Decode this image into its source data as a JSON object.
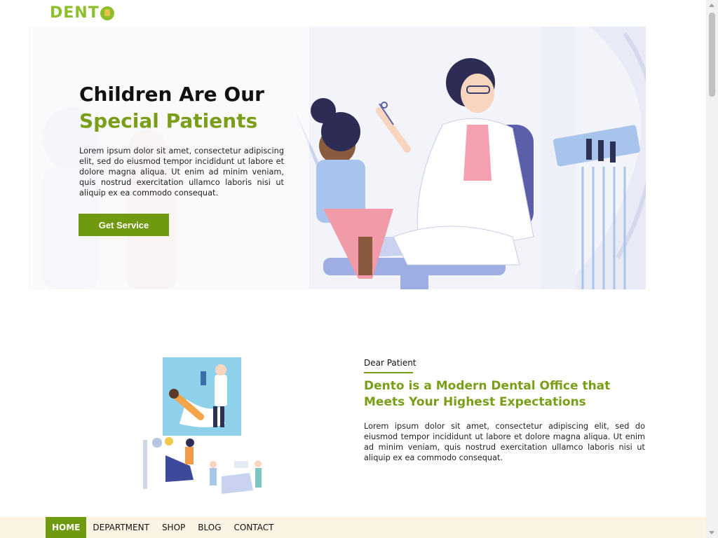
{
  "brand": {
    "logo_text": "DENT",
    "logo_icon": "tooth-icon"
  },
  "hero": {
    "title_line1": "Children Are Our",
    "title_line2": "Special Patients",
    "text": "Lorem ipsum dolor sit amet, consectetur adipiscing elit, sed do eiusmod tempor incididunt ut labore et dolore magna aliqua. Ut enim ad minim veniam, quis nostrud exercitation ullamco laboris nisi ut aliquip ex ea commodo consequat.",
    "button_label": "Get Service"
  },
  "about": {
    "kicker": "Dear Patient",
    "title": "Dento is a Modern Dental Office that Meets Your Highest Expectations",
    "text": "Lorem ipsum dolor sit amet, consectetur adipiscing elit, sed do eiusmod tempor incididunt ut labore et dolore magna aliqua. Ut enim ad minim veniam, quis nostrud exercitation ullamco laboris nisi ut aliquip ex ea commodo consequat."
  },
  "nav": {
    "items": [
      {
        "label": "HOME",
        "active": true
      },
      {
        "label": "DEPARTMENT",
        "active": false
      },
      {
        "label": "SHOP",
        "active": false
      },
      {
        "label": "BLOG",
        "active": false
      },
      {
        "label": "CONTACT",
        "active": false
      }
    ]
  },
  "colors": {
    "accent": "#7a9e18",
    "button": "#6f9a0f",
    "logo": "#8cbf2a",
    "nav_bg": "#fcf4e2"
  }
}
